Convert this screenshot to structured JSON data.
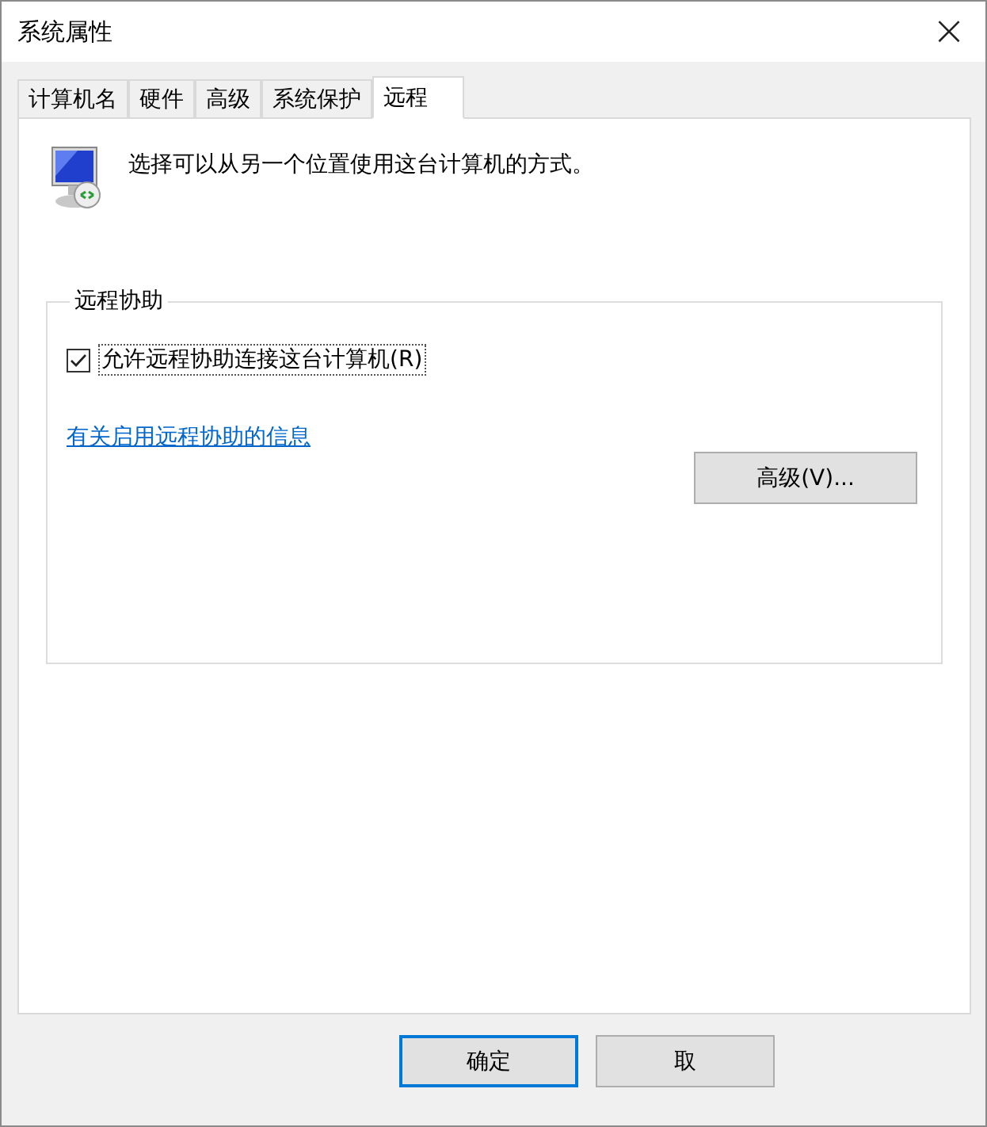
{
  "window": {
    "title": "系统属性",
    "close": "×"
  },
  "tabs": [
    {
      "label": "计算机名",
      "selected": false
    },
    {
      "label": "硬件",
      "selected": false
    },
    {
      "label": "高级",
      "selected": false
    },
    {
      "label": "系统保护",
      "selected": false
    },
    {
      "label": "远程",
      "selected": true
    }
  ],
  "description": "选择可以从另一个位置使用这台计算机的方式。",
  "group": {
    "title": "远程协助",
    "checkbox": {
      "label": "允许远程协助连接这台计算机(R)",
      "checked": true
    },
    "link": "有关启用远程协助的信息",
    "button": "高级(V)..."
  },
  "buttons": [
    {
      "label": "确定",
      "default": true
    },
    {
      "label": "取",
      "default": false
    }
  ]
}
